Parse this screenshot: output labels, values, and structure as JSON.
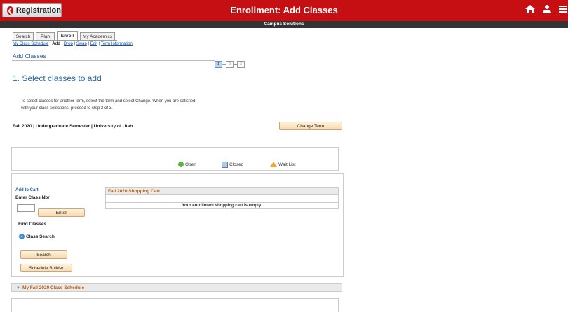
{
  "header": {
    "back_label": "Registration",
    "title": "Enrollment: Add Classes",
    "subtitle": "Campus Solutions",
    "home_icon": "home-icon",
    "user_icon": "user-icon",
    "menu_icon": "menu-icon",
    "brand_color": "#c50f12"
  },
  "tabs": [
    "Search",
    "Plan",
    "Enroll",
    "My Academics"
  ],
  "subnav": {
    "item_0": "My Class Schedule",
    "sep": "|",
    "item_1": "Add",
    "item_2": "Drop",
    "item_3": "Swap",
    "item_4": "Edit",
    "item_5": "Term Information"
  },
  "page": {
    "section_title": "Add Classes",
    "steps": [
      "1",
      "2",
      "3"
    ],
    "heading": "1.  Select classes to add",
    "instructions_line1": "To select classes for another term, select the term and select Change.  When you are satisfied",
    "instructions_line2": "with your class selections, proceed to step 2 of 3.",
    "term": "Fall 2020 | Undergraduate Semester | University of Utah",
    "change_term": "Change Term"
  },
  "legend": {
    "open": "Open",
    "closed": "Closed",
    "waitlist": "Wait List"
  },
  "add": {
    "add_to_cart": "Add to Cart",
    "enter_class_nbr": "Enter Class Nbr",
    "class_nbr_value": "",
    "enter_button": "Enter",
    "find_classes": "Find Classes",
    "class_search": "Class Search",
    "search_button": "Search",
    "schedule_builder": "Schedule Builder"
  },
  "cart": {
    "title": "Fall 2020 Shopping Cart",
    "empty": "Your enrollment shopping cart is empty."
  },
  "schedule": {
    "title": "My Fall 2020 Class Schedule"
  }
}
